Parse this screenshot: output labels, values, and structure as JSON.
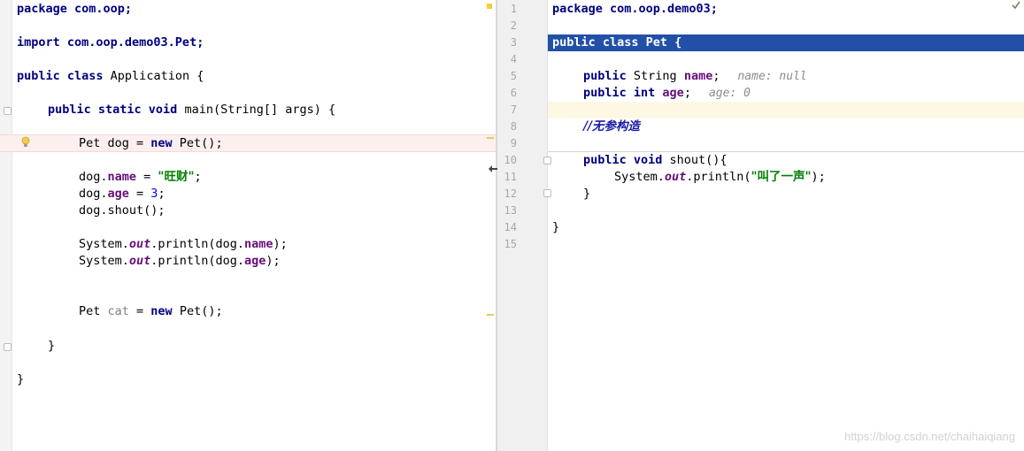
{
  "left_editor": {
    "line_package": "package com.oop;",
    "line_import": "import com.oop.demo03.Pet;",
    "class_decl": {
      "kw": "public class",
      "name": " Application {"
    },
    "main_decl": {
      "kw": "public static void",
      "rest": " main(String[] args) {"
    },
    "new_dog": {
      "pre": "Pet dog = ",
      "kw": "new",
      "post": " Pet();"
    },
    "dog_name": {
      "pre": "dog.",
      "field": "name",
      "mid": " = ",
      "str": "\"旺财\"",
      "end": ";"
    },
    "dog_age": {
      "pre": "dog.",
      "field": "age",
      "mid": " = ",
      "num": "3",
      "end": ";"
    },
    "dog_shout": "dog.shout();",
    "print_name": {
      "pre": "System.",
      "out": "out",
      "mid": ".println(dog.",
      "field": "name",
      "end": ");"
    },
    "print_age": {
      "pre": "System.",
      "out": "out",
      "mid": ".println(dog.",
      "field": "age",
      "end": ");"
    },
    "new_cat": {
      "pre": "Pet ",
      "var": "cat",
      "mid": " = ",
      "kw": "new",
      "post": " Pet();"
    },
    "close_main": "}",
    "close_class": "}"
  },
  "right_editor": {
    "line_numbers": [
      "1",
      "2",
      "3",
      "4",
      "5",
      "6",
      "7",
      "8",
      "9",
      "10",
      "11",
      "12",
      "13",
      "14",
      "15"
    ],
    "line_package": "package com.oop.demo03;",
    "class_decl": "public class Pet {",
    "field_name": {
      "kw": "public",
      "type": " String ",
      "field": "name",
      "end": ";",
      "hint": "name: null"
    },
    "field_age": {
      "kw": "public int",
      "mid": " ",
      "field": "age",
      "end": ";",
      "hint": "age: 0"
    },
    "comment": "//无参构造",
    "shout_decl": {
      "kw": "public void",
      "rest": " shout(){"
    },
    "println": {
      "pre": "System.",
      "out": "out",
      "mid": ".println(",
      "str": "\"叫了一声\"",
      "end": ");"
    },
    "close_method": "}",
    "close_class": "}"
  },
  "watermark": "https://blog.csdn.net/chaihaiqiang",
  "colors": {
    "keyword": "#000080",
    "field": "#660e7a",
    "string": "#008000",
    "number": "#0000ff",
    "selection": "#2150a6",
    "error_line": "#fcf0ef"
  },
  "icons": [
    "lightbulb-icon",
    "resize-splitter-icon",
    "fold-marker-icon",
    "inspection-ok-icon"
  ]
}
